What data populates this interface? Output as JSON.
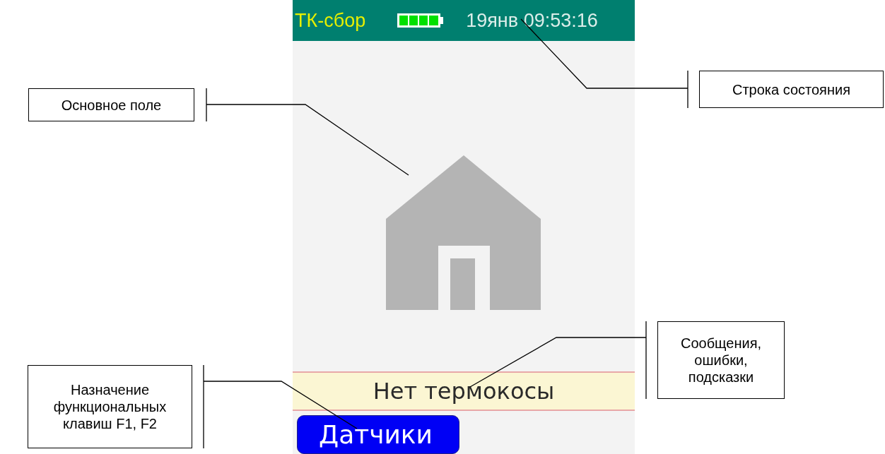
{
  "status_bar": {
    "app_name": "ТК-сбор",
    "datetime": "19янв 09:53:16"
  },
  "message": "Нет термокосы",
  "softkeys": [
    {
      "label": "Датчики"
    }
  ],
  "left_callouts": [
    {
      "lines": [
        "Основное поле"
      ]
    },
    {
      "lines": [
        "Назначение",
        "функциональных",
        "клавиш F1, F2"
      ]
    }
  ],
  "right_callouts": [
    {
      "lines": [
        "Строка состояния"
      ]
    },
    {
      "lines": [
        "Сообщения,",
        "ошибки,",
        "подсказки"
      ]
    }
  ]
}
